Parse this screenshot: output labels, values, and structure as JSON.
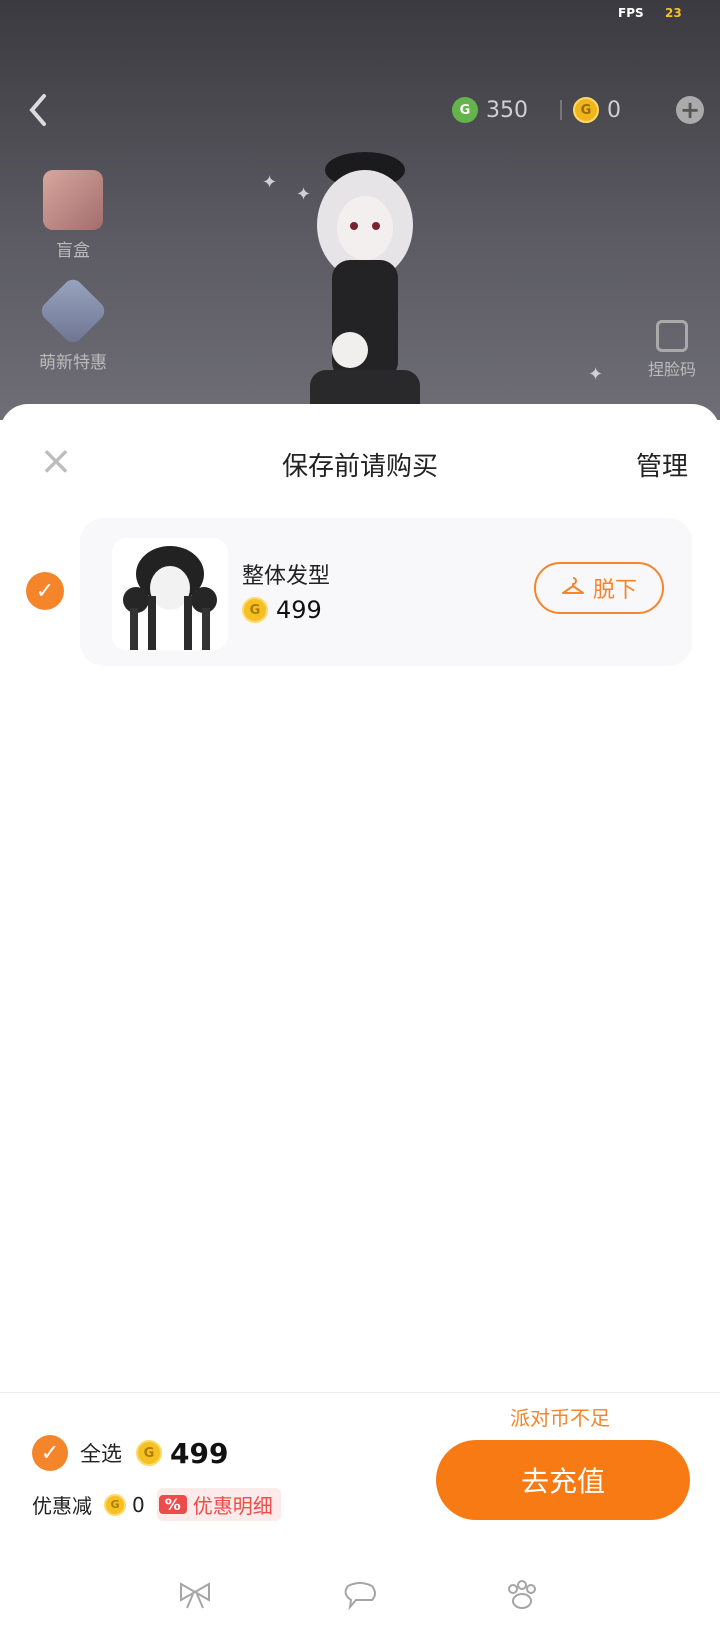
{
  "status": {
    "fps_label": "FPS",
    "fps_value": "23"
  },
  "header": {
    "back_icon": "chevron-left-icon",
    "currency_green": {
      "icon": "g-coin-green-icon",
      "value": "350"
    },
    "currency_gold": {
      "icon": "g-coin-gold-icon",
      "value": "0"
    },
    "add_icon": "plus-circle-icon"
  },
  "side_menu": [
    {
      "label": "盲盒",
      "icon": "gift-box-icon"
    },
    {
      "label": "萌新特惠",
      "icon": "card-pack-icon"
    }
  ],
  "face_button": {
    "label": "捏脸码",
    "icon": "edit-face-icon"
  },
  "sheet": {
    "title": "保存前请购买",
    "manage_label": "管理",
    "close_icon": "close-icon"
  },
  "items": [
    {
      "name": "整体发型",
      "price": "499",
      "selected": true,
      "remove_label": "脱下"
    }
  ],
  "footer": {
    "warning": "派对币不足",
    "select_all_label": "全选",
    "total": "499",
    "discount_label": "优惠减",
    "discount_value": "0",
    "discount_tag_icon": "%",
    "discount_detail_label": "优惠明细",
    "recharge_label": "去充值"
  },
  "bottom_tabs": [
    {
      "icon": "bow-icon"
    },
    {
      "icon": "cloud-speech-icon"
    },
    {
      "icon": "paw-icon"
    }
  ],
  "colors": {
    "accent": "#f5852a",
    "recharge": "#f87a15",
    "discount": "#ef4b4b"
  }
}
